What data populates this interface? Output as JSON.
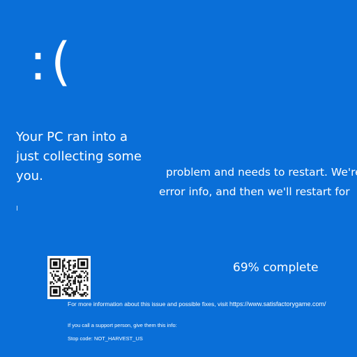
{
  "screen": {
    "background_color": "#0a6fd8",
    "emoticon": ":(",
    "message_left": [
      "Your PC ran into a",
      "just collecting some",
      "you."
    ],
    "message_right": [
      "problem and needs to restart. We're",
      "error info, and then we'll restart for"
    ],
    "progress": {
      "percent": 69,
      "text": "69% complete"
    },
    "qr_icon": "qr-code-icon",
    "more_info_text": "For more information about this issue and possible fixes, visit ",
    "more_info_link": "https://www.satisfactorygame.com/",
    "support_text": "If you call a support person, give them this info:",
    "stop_code_label": "Stop code: ",
    "stop_code": "NOT_HARVEST_US"
  }
}
